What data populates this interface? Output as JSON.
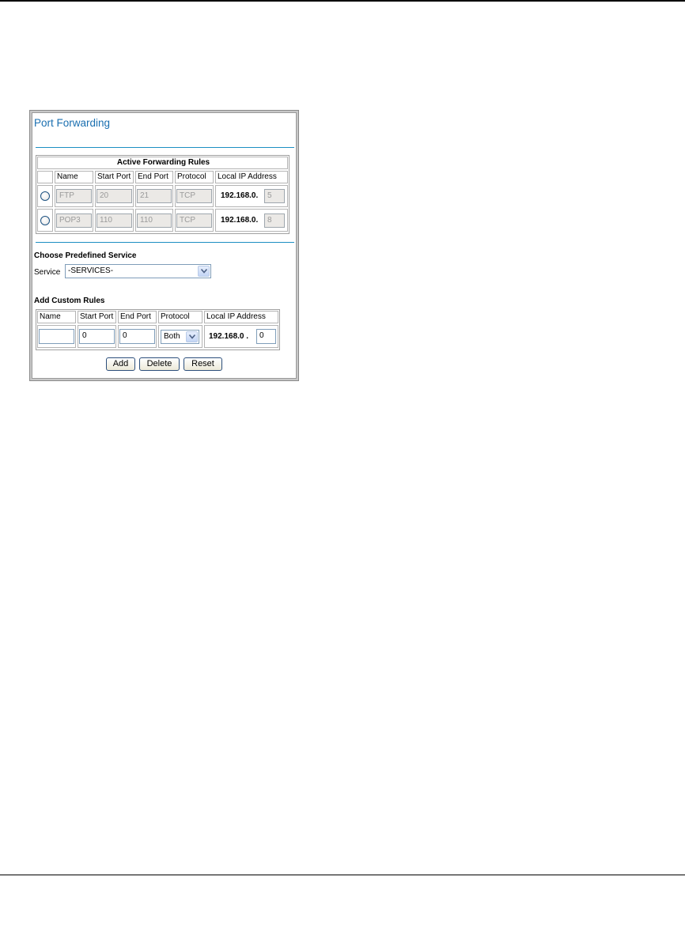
{
  "page": {
    "title": "Port Forwarding"
  },
  "active_rules": {
    "caption": "Active Forwarding Rules",
    "columns": [
      "",
      "Name",
      "Start Port",
      "End Port",
      "Protocol",
      "Local IP Address"
    ],
    "rows": [
      {
        "name": "FTP",
        "start_port": "20",
        "end_port": "21",
        "protocol": "TCP",
        "ip_prefix": "192.168.0.",
        "ip_last": "5"
      },
      {
        "name": "POP3",
        "start_port": "110",
        "end_port": "110",
        "protocol": "TCP",
        "ip_prefix": "192.168.0.",
        "ip_last": "8"
      }
    ]
  },
  "predefined": {
    "heading": "Choose Predefined Service",
    "label": "Service",
    "selected": "-SERVICES-"
  },
  "custom": {
    "heading": "Add Custom Rules",
    "columns": [
      "Name",
      "Start Port",
      "End Port",
      "Protocol",
      "Local IP Address"
    ],
    "name_value": "",
    "start_port": "0",
    "end_port": "0",
    "protocol": "Both",
    "ip_prefix": "192.168.0 .",
    "ip_last": "0"
  },
  "buttons": {
    "add": "Add",
    "delete": "Delete",
    "reset": "Reset"
  },
  "icons": {
    "radio": "radio-button",
    "dropdown": "chevron-down-icon"
  }
}
